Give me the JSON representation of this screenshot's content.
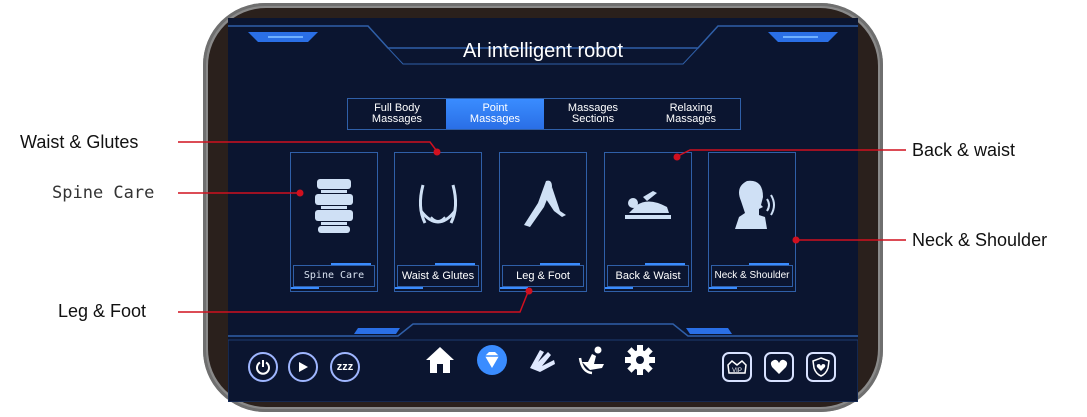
{
  "screen": {
    "title": "AI intelligent robot"
  },
  "tabs": [
    {
      "line1": "Full Body",
      "line2": "Massages",
      "active": false
    },
    {
      "line1": "Point",
      "line2": "Massages",
      "active": true
    },
    {
      "line1": "Massages",
      "line2": "Sections",
      "active": false
    },
    {
      "line1": "Relaxing",
      "line2": "Massages",
      "active": false
    }
  ],
  "cards": [
    {
      "label": "Spine Care",
      "icon": "spine-icon"
    },
    {
      "label": "Waist & Glutes",
      "icon": "waist-icon"
    },
    {
      "label": "Leg & Foot",
      "icon": "leg-icon"
    },
    {
      "label": "Back & Waist",
      "icon": "back-icon"
    },
    {
      "label": "Neck & Shoulder",
      "icon": "neck-icon"
    }
  ],
  "callouts": {
    "waist": "Waist & Glutes",
    "spine": "Spine Care",
    "leg": "Leg & Foot",
    "back": "Back & waist",
    "neck": "Neck & Shoulder"
  },
  "bottom": {
    "left_buttons": [
      "power-icon",
      "play-icon",
      "sleep-icon"
    ],
    "sleep_text": "zzz",
    "nav_icons": [
      "home-icon",
      "diamond-icon",
      "hands-icon",
      "recline-icon",
      "gear-icon"
    ],
    "right_buttons": [
      "vip-crown-icon",
      "heart-icon",
      "shield-heart-icon"
    ],
    "vip_text": "VIP"
  },
  "colors": {
    "screen_bg": "#0b1530",
    "accent": "#3a8cff",
    "border": "#2f5fa8",
    "callout_line": "#d0101f"
  }
}
